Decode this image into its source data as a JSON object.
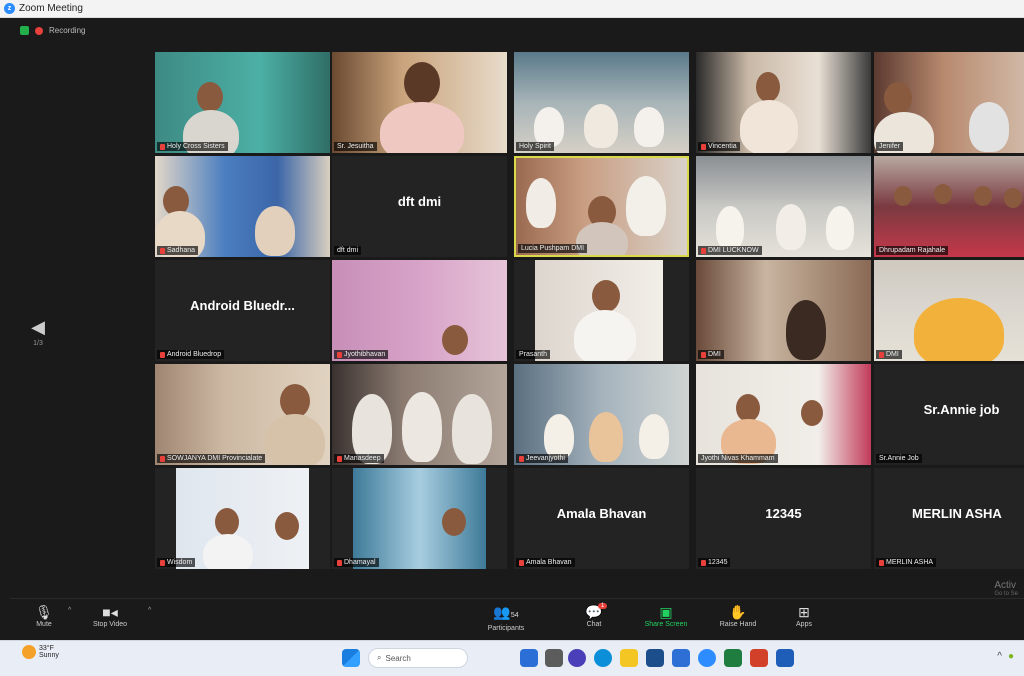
{
  "window": {
    "title": "Zoom Meeting"
  },
  "meeting": {
    "recording_label": "Recording",
    "page_number": "1/3"
  },
  "tiles": [
    {
      "label": "Holy Cross Sisters",
      "center": "",
      "muted": true
    },
    {
      "label": "Sr. Jesuitha",
      "center": "",
      "muted": false
    },
    {
      "label": "Holy Spirit",
      "center": "",
      "muted": false
    },
    {
      "label": "Vincentia",
      "center": "",
      "muted": true
    },
    {
      "label": "Jenifer",
      "center": "",
      "muted": false
    },
    {
      "label": "Sadhana",
      "center": "",
      "muted": true
    },
    {
      "label": "dft dmi",
      "center": "dft dmi",
      "muted": false
    },
    {
      "label": "Lucia Pushpam DMI",
      "center": "",
      "muted": false
    },
    {
      "label": "DMI LUCKNOW",
      "center": "",
      "muted": true
    },
    {
      "label": "Dhrupadam Rajahale",
      "center": "",
      "muted": false
    },
    {
      "label": "Android Bluedrop",
      "center": "Android Bluedr...",
      "muted": true
    },
    {
      "label": "Jyothibhavan",
      "center": "",
      "muted": true
    },
    {
      "label": "Prasanth",
      "center": "",
      "muted": false
    },
    {
      "label": "DMI",
      "center": "",
      "muted": true
    },
    {
      "label": "DMI",
      "center": "",
      "muted": true
    },
    {
      "label": "SOWJANYA DMI Provincialate",
      "center": "",
      "muted": true
    },
    {
      "label": "Manasdeep",
      "center": "",
      "muted": true
    },
    {
      "label": "Jeevanjyothi",
      "center": "",
      "muted": true
    },
    {
      "label": "Jyothi Nivas Khammam",
      "center": "",
      "muted": false
    },
    {
      "label": "Sr.Annie Job",
      "center": "Sr.Annie job",
      "muted": false
    },
    {
      "label": "Wisdom",
      "center": "",
      "muted": true
    },
    {
      "label": "Dhamayal",
      "center": "",
      "muted": true
    },
    {
      "label": "Amala Bhavan",
      "center": "Amala Bhavan",
      "muted": true
    },
    {
      "label": "12345",
      "center": "12345",
      "muted": true
    },
    {
      "label": "MERLIN ASHA",
      "center": "MERLIN ASHA",
      "muted": true
    }
  ],
  "toolbar": {
    "mute": "Mute",
    "stop_video": "Stop Video",
    "participants": "Participants",
    "participants_count": "54",
    "chat": "Chat",
    "chat_badge": "1",
    "share_screen": "Share Screen",
    "raise_hand": "Raise Hand",
    "apps": "Apps"
  },
  "watermark": {
    "line1": "Activ",
    "line2": "Go to Se"
  },
  "taskbar": {
    "weather_temp": "33°F",
    "weather_desc": "Sunny",
    "search": "Search"
  },
  "colors": {
    "accent": "#23d160",
    "muted": "#e8403a",
    "active_speaker": "#d9d94a"
  }
}
